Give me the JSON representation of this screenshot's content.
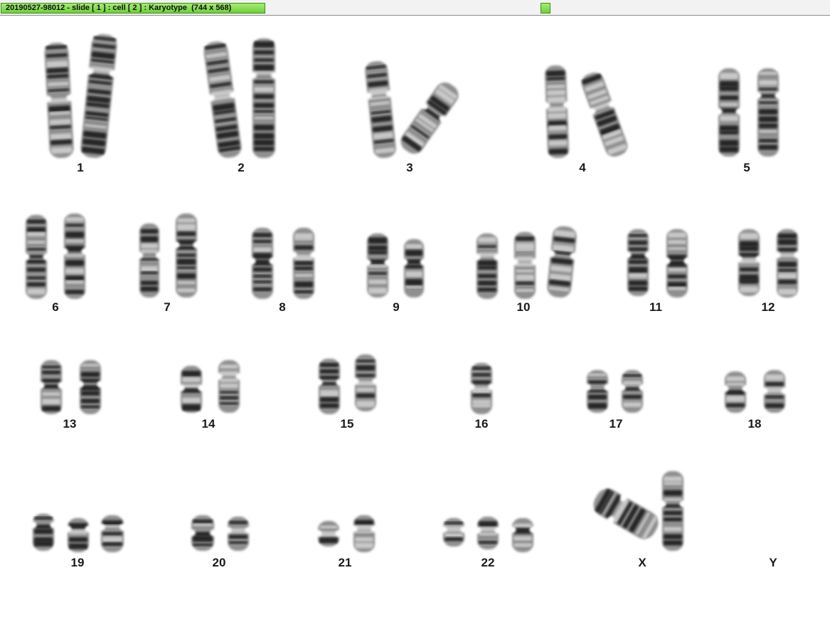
{
  "window": {
    "title": "20190527-98012 - slide [ 1 ] : cell [ 2 ] : Karyotype  (744 x 568)"
  },
  "karyotype": {
    "groups": [
      {
        "label": "1"
      },
      {
        "label": "2"
      },
      {
        "label": "3"
      },
      {
        "label": "4"
      },
      {
        "label": "5"
      },
      {
        "label": "6"
      },
      {
        "label": "7"
      },
      {
        "label": "8"
      },
      {
        "label": "9"
      },
      {
        "label": "10"
      },
      {
        "label": "11"
      },
      {
        "label": "12"
      },
      {
        "label": "13"
      },
      {
        "label": "14"
      },
      {
        "label": "15"
      },
      {
        "label": "16"
      },
      {
        "label": "17"
      },
      {
        "label": "18"
      },
      {
        "label": "19"
      },
      {
        "label": "20"
      },
      {
        "label": "21"
      },
      {
        "label": "22"
      },
      {
        "label": "X"
      },
      {
        "label": "Y"
      }
    ]
  }
}
